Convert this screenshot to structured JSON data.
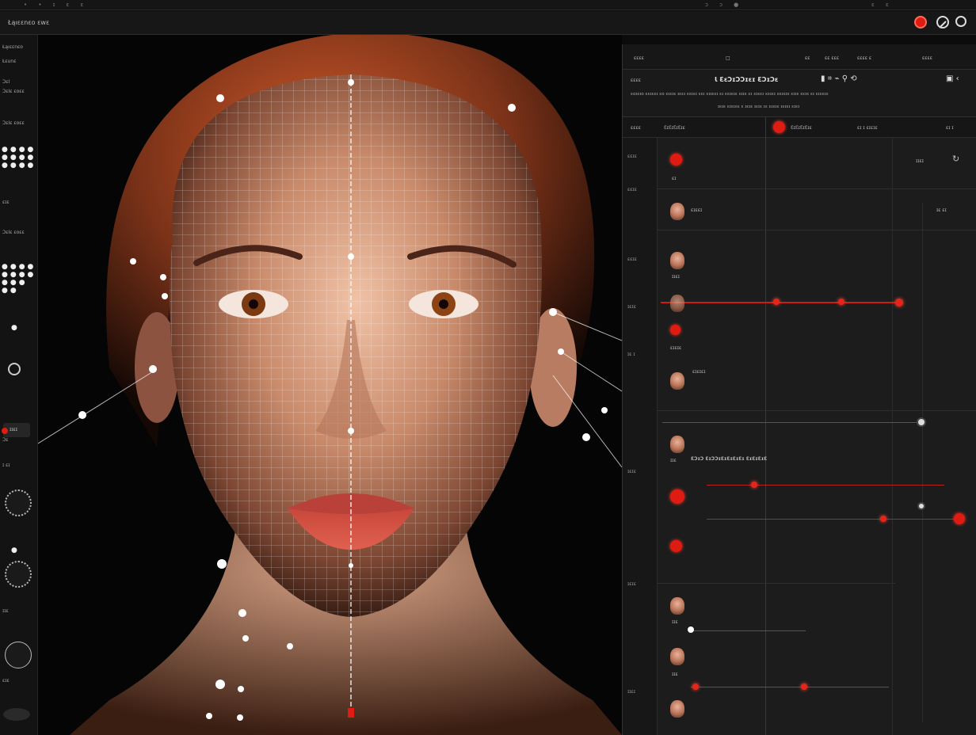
{
  "window": {
    "title": ""
  },
  "menubar": {
    "title": "Łąıεεnεo  ɛwɛ",
    "icons": [
      "record-icon",
      "no-entry-icon",
      "circle-icon"
    ]
  },
  "left_toolbar": {
    "labels": [
      "Łąıɛɛnɛo",
      "Łɛunɛ",
      "ƆɛI",
      "ƆɛIɛ ɛoɛɛ",
      "ƆɛIɛ ɛoɛɛ",
      "ɛɪɛ",
      "ƆɛIɛ ɛoɛɛ",
      "Ͻɛ",
      "ɪ ɛɪ",
      "ɪɪɛ",
      "ɛɪɛ"
    ],
    "chip_label": "ɪɪɛɪ"
  },
  "panel": {
    "toolbar_items": [
      "ɛɛɛɛ",
      "□",
      "ɛɛ",
      "ɛɛ ɛɛɛ",
      "ɛɛɛɛ ɛ",
      "ɛɛɛɛ"
    ],
    "header_left": "ɛɛɛɛ",
    "title": "Ɩ ƐɛƆɪƆƆɪɛɪ ƐƆɪƆɛ",
    "subrow": "ɛoɪɛɪo ɛɛɪɛɛɪ ɛo ɛɪɛɪɛ ɪɛɛɪ ɛɛɪɛɪ ɛɛɪ ɛɪɪɛɛɪ ɛɪ ɛɛɪɛɪɛ ɛɪɪɛ ɛɪ ɛɪɛɛɪ ɛɛɪɛɪ ɛɛɪɛɪɛ ɛɪɪɛ ɛɛɪɛ ɛɪ ɛɪɛɛɪɛ",
    "subrow2": "ɪɛɪɛ ɛɪɛɪɛɛ ɛ ɪɛɪɛ ɪɛɪɛ ɪɛ ɛɪɛɪɛ ɪɛɪɛɪ ɛɪɛɪ",
    "col_head": [
      "ɛɛɛɛ",
      "ƐɪƐɪƐɪƐɪɛ",
      "ƐɪƐɪƐɪƐɪɛ",
      "ɛɪ ɪ ɛɪɛɪɛ",
      "ɛɪ ɪ"
    ],
    "rows": [
      {
        "label": "ɛɪ",
        "meta": "ɪɪɛɪ"
      },
      {
        "label": "ɛɪɛɛɪ",
        "meta": "ɪɛ ɛɪ"
      },
      {
        "label": "ɪɪɛɪ",
        "meta": ""
      },
      {
        "label": "ɛɪɛɪɛ",
        "meta": ""
      },
      {
        "label": "ɛɪɛɪɛɪ",
        "meta": ""
      },
      {
        "label": "ɪɪɛ",
        "meta": ""
      },
      {
        "label": "ƐƆɪƆ ƐɪƆƆɪƐɪƐɪƐɪƐɪ ƐɪƐɪƐɪƐ",
        "meta": ""
      },
      {
        "label": "ɪɪɛ",
        "meta": ""
      },
      {
        "label": "ɪɪɛ",
        "meta": ""
      }
    ],
    "side_labels": [
      "ɛɛɪɛ",
      "ɛɛɪɛ",
      "ɛɛɪɛ",
      "ɪɛɪɛ",
      "ɪɛ ɪ",
      "ɪɛɪɛ",
      "ɪɛɪɛ",
      "ɪɪɛɪ"
    ]
  },
  "colors": {
    "accent": "#e01b12",
    "panel_bg": "#1c1c1c",
    "viewport_bg": "#050505"
  }
}
